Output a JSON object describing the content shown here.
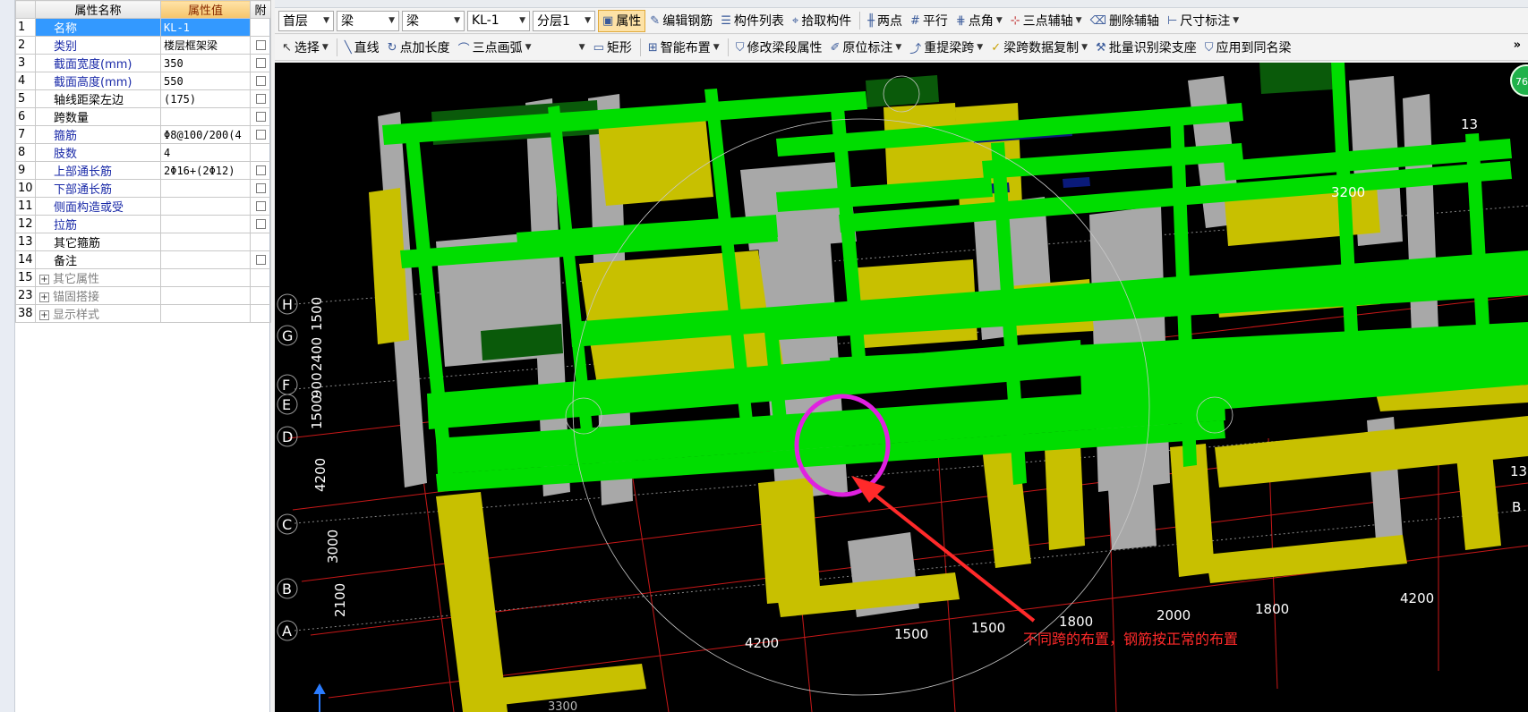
{
  "prop_grid": {
    "headers": {
      "name": "属性名称",
      "value": "属性值",
      "extra": "附"
    },
    "rows": [
      {
        "num": "1",
        "name": "名称",
        "value": "KL-1"
      },
      {
        "num": "2",
        "name": "类别",
        "value": "楼层框架梁"
      },
      {
        "num": "3",
        "name": "截面宽度(mm)",
        "value": "350"
      },
      {
        "num": "4",
        "name": "截面高度(mm)",
        "value": "550"
      },
      {
        "num": "5",
        "name": "轴线距梁左边",
        "value": "(175)"
      },
      {
        "num": "6",
        "name": "跨数量",
        "value": ""
      },
      {
        "num": "7",
        "name": "箍筋",
        "value": "Φ8@100/200(4"
      },
      {
        "num": "8",
        "name": "肢数",
        "value": "4"
      },
      {
        "num": "9",
        "name": "上部通长筋",
        "value": "2Φ16+(2Φ12)"
      },
      {
        "num": "10",
        "name": "下部通长筋",
        "value": ""
      },
      {
        "num": "11",
        "name": "侧面构造或受",
        "value": ""
      },
      {
        "num": "12",
        "name": "拉筋",
        "value": ""
      },
      {
        "num": "13",
        "name": "其它箍筋",
        "value": ""
      },
      {
        "num": "14",
        "name": "备注",
        "value": ""
      },
      {
        "num": "15",
        "name": "其它属性",
        "value": ""
      },
      {
        "num": "23",
        "name": "锚固搭接",
        "value": ""
      },
      {
        "num": "38",
        "name": "显示样式",
        "value": ""
      }
    ]
  },
  "toolbar1": {
    "floor": "首层",
    "type1": "梁",
    "type2": "梁",
    "component": "KL-1",
    "layer": "分层1",
    "btn_property": "属性",
    "btn_edit_rebar": "编辑钢筋",
    "btn_component_list": "构件列表",
    "btn_pick": "拾取构件",
    "btn_two_points": "两点",
    "btn_parallel": "平行",
    "btn_point_angle": "点角",
    "btn_three_point_axis": "三点辅轴",
    "btn_delete_axis": "删除辅轴",
    "btn_dimension": "尺寸标注"
  },
  "toolbar2": {
    "btn_select": "选择",
    "btn_line": "直线",
    "btn_point_length": "点加长度",
    "btn_three_point_arc": "三点画弧",
    "btn_rect": "矩形",
    "btn_smart_layout": "智能布置",
    "btn_modify_span": "修改梁段属性",
    "btn_original_mark": "原位标注",
    "btn_re_extract": "重提梁跨",
    "btn_span_copy": "梁跨数据复制",
    "btn_batch_identify": "批量识别梁支座",
    "btn_apply_same": "应用到同名梁",
    "more": "»"
  },
  "canvas": {
    "annotation": "不同跨的布置，钢筋按正常的布置",
    "axis_letters": [
      "H",
      "G",
      "F",
      "E",
      "D",
      "C",
      "B",
      "A"
    ],
    "left_dims": [
      "1500",
      "2400",
      "900",
      "1500",
      "4200",
      "3000",
      "2100"
    ],
    "bottom_dims": [
      "4200",
      "1500",
      "1500",
      "1800",
      "2000",
      "1800",
      "4200"
    ],
    "top_dim": "3200",
    "right_labels": [
      "13",
      "13",
      "B"
    ],
    "top_right_badge": "76",
    "bottom_partial": "3300",
    "colors": {
      "green": "#00dd00",
      "dark_green": "#0a5a0a",
      "yellow": "#c8c000",
      "gray": "#a8a8a8",
      "magenta": "#e020e0",
      "red": "#ff2a2a",
      "navy": "#0a1a7a"
    }
  }
}
